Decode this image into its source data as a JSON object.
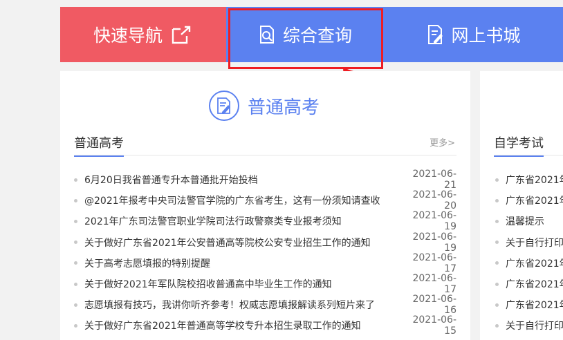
{
  "nav": {
    "quick_label": "快速导航",
    "query_label": "综合查询",
    "shop_label": "网上书城"
  },
  "main": {
    "heading": "普通高考",
    "section_title": "普通高考",
    "more_label": "更多>",
    "news": [
      {
        "title": "6月20日我省普通专升本普通批开始投档",
        "date": "2021-06-21"
      },
      {
        "title": "@2021年报考中央司法警官学院的广东省考生，这有一份须知请查收",
        "date": "2021-06-20"
      },
      {
        "title": "2021年广东司法警官职业学院司法行政警察类专业报考须知",
        "date": "2021-06-19"
      },
      {
        "title": "关于做好广东省2021年公安普通高等院校公安专业招生工作的通知",
        "date": "2021-06-19"
      },
      {
        "title": "关于高考志愿填报的特别提醒",
        "date": "2021-06-17"
      },
      {
        "title": "关于做好2021年军队院校招收普通高中毕业生工作的通知",
        "date": "2021-06-17"
      },
      {
        "title": "志愿填报有技巧，我讲你听齐参考！权威志愿填报解读系列短片来了",
        "date": "2021-06-16"
      },
      {
        "title": "关于做好广东省2021年普通高等学校专升本招生录取工作的通知",
        "date": "2021-06-15"
      }
    ]
  },
  "side": {
    "section_title": "自学考试",
    "items": [
      "广东省2021年",
      "广东省2021年",
      "温馨提示",
      "关于自行打印",
      "广东省2021年",
      "广东省2021年",
      "广东省2021年",
      "关于自行打印"
    ]
  },
  "colors": {
    "red": "#f05a63",
    "blue": "#5b81f0",
    "highlight": "#ee1d23"
  }
}
